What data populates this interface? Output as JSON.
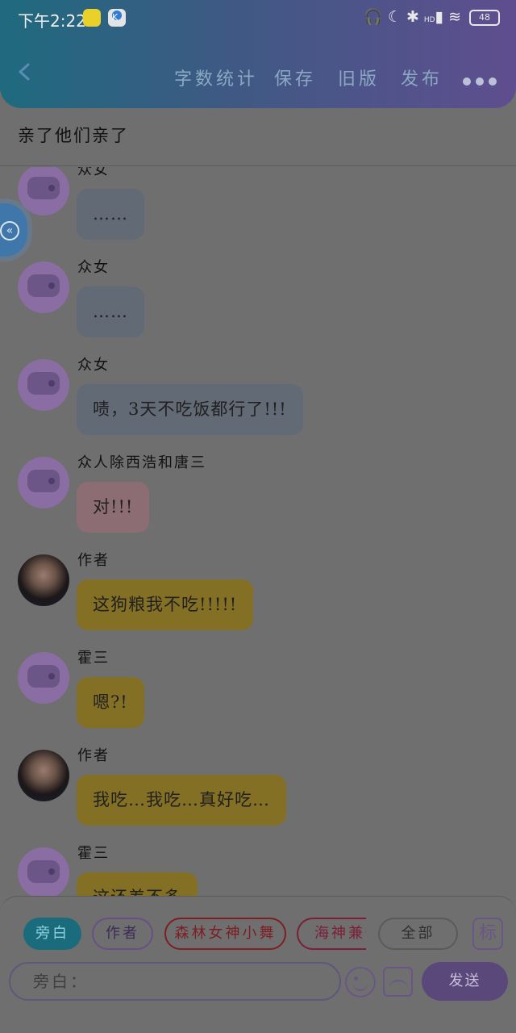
{
  "status_bar": {
    "time": "下午2:22",
    "signal_text": "HD",
    "battery": "48"
  },
  "header": {
    "nav": [
      "字数统计",
      "保存",
      "旧版",
      "发布"
    ]
  },
  "chapter_title": "亲了他们亲了",
  "messages": [
    {
      "name": "众女",
      "text": "……",
      "avatar": "bot-icon",
      "color": "gray"
    },
    {
      "name": "众女",
      "text": "……",
      "avatar": "bot-icon",
      "color": "gray"
    },
    {
      "name": "众女",
      "text": "啧，3天不吃饭都行了!!!",
      "avatar": "bot-icon",
      "color": "gray"
    },
    {
      "name": "众人除西浩和唐三",
      "text": "对!!!",
      "avatar": "bot-icon",
      "color": "pink"
    },
    {
      "name": "作者",
      "text": "这狗粮我不吃!!!!!",
      "avatar": "photo",
      "color": "yellow"
    },
    {
      "name": "霍三",
      "text": "嗯?!",
      "avatar": "bot-icon",
      "color": "yellow"
    },
    {
      "name": "作者",
      "text": "我吃…我吃…真好吃…",
      "avatar": "photo",
      "color": "yellow"
    },
    {
      "name": "霍三",
      "text": "这还差不多",
      "avatar": "bot-icon",
      "color": "yellow"
    }
  ],
  "role_chips": [
    "旁白",
    "作者",
    "森林女神小舞",
    "海神兼修",
    "全部"
  ],
  "mark_button": "标",
  "input": {
    "placeholder": "旁白："
  },
  "send_label": "发送",
  "colors": {
    "header_start": "#1f6a7e",
    "header_end": "#5f4e8f",
    "accent": "#5b487a"
  }
}
